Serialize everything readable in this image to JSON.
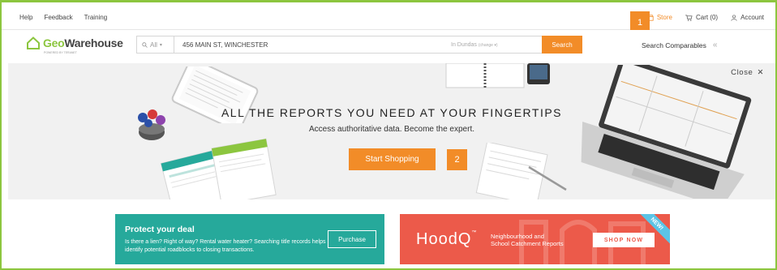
{
  "topbar": {
    "links": [
      "Help",
      "Feedback",
      "Training"
    ],
    "store": "Store",
    "cart": "Cart (0)",
    "account": "Account"
  },
  "header": {
    "logo_text": "GeoWarehouse",
    "logo_tagline": "POWERED BY TERANET",
    "search_scope": "All",
    "search_query": "456 MAIN ST, WINCHESTER",
    "search_region": "In Dundas",
    "search_region_change": "(change ▾)",
    "search_button": "Search",
    "comparables": "Search Comparables"
  },
  "hero": {
    "close_label": "Close",
    "title": "ALL THE REPORTS YOU NEED AT YOUR FINGERTIPS",
    "subtitle": "Access authoritative data. Become the expert.",
    "cta": "Start Shopping"
  },
  "badges": {
    "first": "1",
    "second": "2"
  },
  "banner_left": {
    "title": "Protect your deal",
    "description": "Is there a lien? Right of way? Rental water heater? Searching title records helps identify potential roadblocks to closing transactions.",
    "button": "Purchase"
  },
  "banner_right": {
    "brand": "HoodQ",
    "tagline_line1": "Neighbourhood and",
    "tagline_line2": "School Catchment Reports",
    "button": "SHOP NOW",
    "ribbon": "NEW!"
  },
  "colors": {
    "accent": "#f28c28",
    "brand_green": "#8cc63f",
    "teal": "#26a99b",
    "coral": "#ec5a4a"
  }
}
